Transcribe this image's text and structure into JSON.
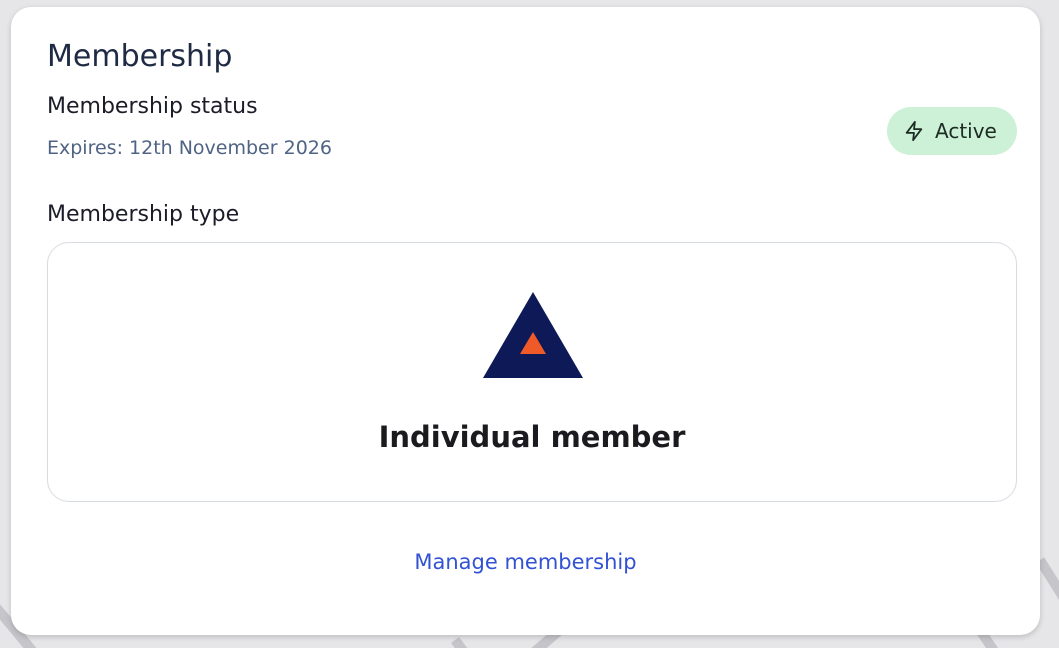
{
  "card": {
    "title": "Membership",
    "status_label": "Membership status",
    "expires": "Expires: 12th November 2026",
    "status_badge": {
      "label": "Active",
      "icon": "lightning-bolt-icon",
      "background": "#cdf1d6"
    },
    "type_label": "Membership type",
    "membership_type": {
      "name": "Individual member",
      "logo": "triangle-logo",
      "logo_colors": {
        "outer": "#0d1a57",
        "inner": "#f05a28"
      }
    },
    "manage_link": "Manage membership"
  },
  "colors": {
    "link": "#3252d4",
    "title": "#1f2a44",
    "muted": "#4f6384"
  }
}
